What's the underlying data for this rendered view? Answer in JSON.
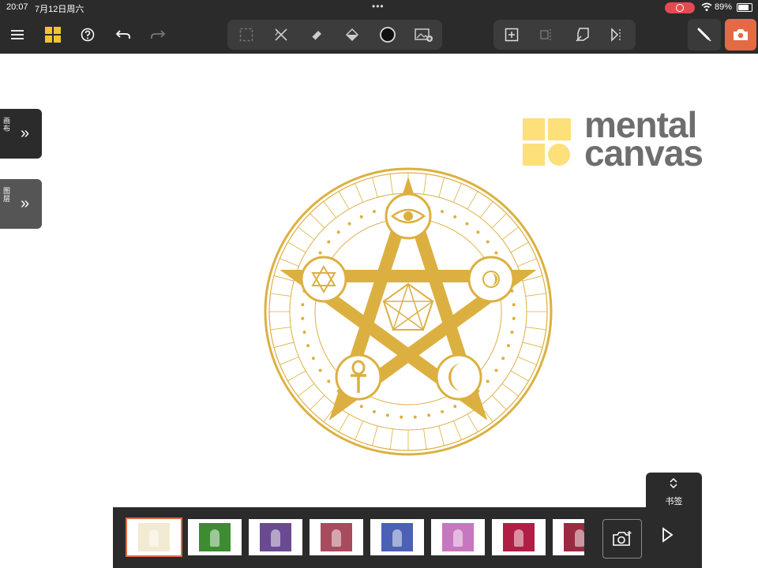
{
  "status_bar": {
    "time": "20:07",
    "date": "7月12日周六",
    "multitask": "•••",
    "battery": "89%"
  },
  "toolbar": {
    "left_icons": [
      "menu-icon",
      "gallery-icon",
      "help-icon",
      "undo-icon",
      "redo-icon"
    ],
    "tools": [
      "lasso-icon",
      "cut-icon",
      "eraser-icon",
      "fill-icon",
      "color-icon",
      "image-icon"
    ],
    "canvas_tools": [
      "add-canvas-icon",
      "split-canvas-icon",
      "rotate-canvas-icon",
      "flip-canvas-icon"
    ],
    "draw_icon": "pen-icon",
    "snapshot_icon": "camera-icon",
    "accent": "#e36a43"
  },
  "side_panels": [
    {
      "label": "画布",
      "color": "#2b2b2b"
    },
    {
      "label": "图层",
      "color": "#555555"
    }
  ],
  "brand": {
    "line1": "mental",
    "line2": "canvas",
    "color": "#fde07a"
  },
  "artwork": {
    "description_icon": "pentagram-seal-icon",
    "color": "#dcb040"
  },
  "bookmark": {
    "label": "书签"
  },
  "thumbnails": [
    {
      "color": "#f2ead2",
      "selected": true
    },
    {
      "color": "#3d8c32",
      "selected": false
    },
    {
      "color": "#6a4a92",
      "selected": false
    },
    {
      "color": "#a94b5e",
      "selected": false
    },
    {
      "color": "#4b61b5",
      "selected": false
    },
    {
      "color": "#c777c0",
      "selected": false
    },
    {
      "color": "#b01e45",
      "selected": false
    },
    {
      "color": "#9a2a40",
      "selected": false
    }
  ]
}
